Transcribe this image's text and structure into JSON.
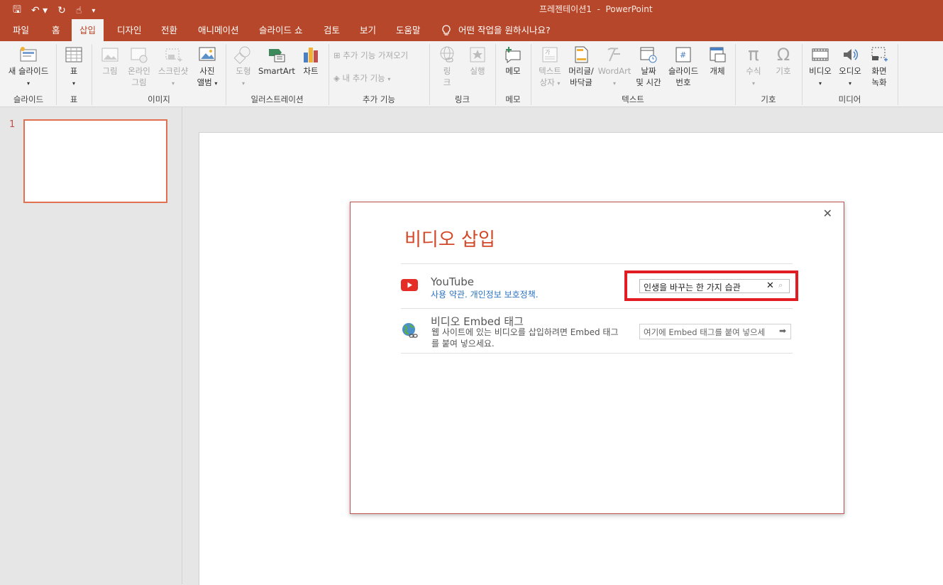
{
  "window": {
    "title": "프레젠테이션1  -  PowerPoint"
  },
  "qat": {
    "save": "🖫",
    "undo": "↶ ▾",
    "redo": "↻",
    "touch": "☝",
    "customize": "▾"
  },
  "tabs": [
    "파일",
    "홈",
    "삽입",
    "디자인",
    "전환",
    "애니메이션",
    "슬라이드 쇼",
    "검토",
    "보기",
    "도움말"
  ],
  "tellme": "어떤 작업을 원하시나요?",
  "ribbon": {
    "new_slide": "새 슬라이드",
    "table": "표",
    "picture": "그림",
    "online_picture_1": "온라인",
    "online_picture_2": "그림",
    "screenshot": "스크린샷",
    "photo_album_1": "사진",
    "photo_album_2": "앨범",
    "shapes": "도형",
    "smartart": "SmartArt",
    "chart": "차트",
    "get_addins": "추가 기능 가져오기",
    "my_addins": "내 추가 기능",
    "link_1": "링",
    "link_2": "크",
    "action": "실행",
    "comment": "메모",
    "textbox_1": "텍스트",
    "textbox_2": "상자",
    "header_footer_1": "머리글/",
    "header_footer_2": "바닥글",
    "wordart": "WordArt",
    "datetime_1": "날짜",
    "datetime_2": "및 시간",
    "slide_number_1": "슬라이드",
    "slide_number_2": "번호",
    "object": "개체",
    "equation": "수식",
    "symbol": "기호",
    "video": "비디오",
    "audio": "오디오",
    "screen_recording_1": "화면",
    "screen_recording_2": "녹화",
    "groups": [
      "슬라이드",
      "표",
      "이미지",
      "일러스트레이션",
      "추가 기능",
      "링크",
      "메모",
      "텍스트",
      "기호",
      "미디어"
    ]
  },
  "slides": {
    "number": "1"
  },
  "dialog": {
    "title": "비디오 삽입",
    "close": "✕",
    "youtube": {
      "name": "YouTube",
      "links": "사용 약관. 개인정보 보호정책.",
      "search_value": "인생을 바꾸는 한 가지 습관",
      "clear": "✕",
      "search_icon": "⌕"
    },
    "embed": {
      "name": "비디오 Embed 태그",
      "desc": "웹 사이트에 있는 비디오를 삽입하려면 Embed 태그를 붙여 넣으세요.",
      "placeholder": "여기에 Embed 태그를 붙여 넣으세",
      "arrow": "➡"
    }
  },
  "colors": {
    "accent": "#b7472a",
    "dialog_title": "#d24726",
    "highlight": "#e31b23",
    "youtube": "#e52d27"
  }
}
